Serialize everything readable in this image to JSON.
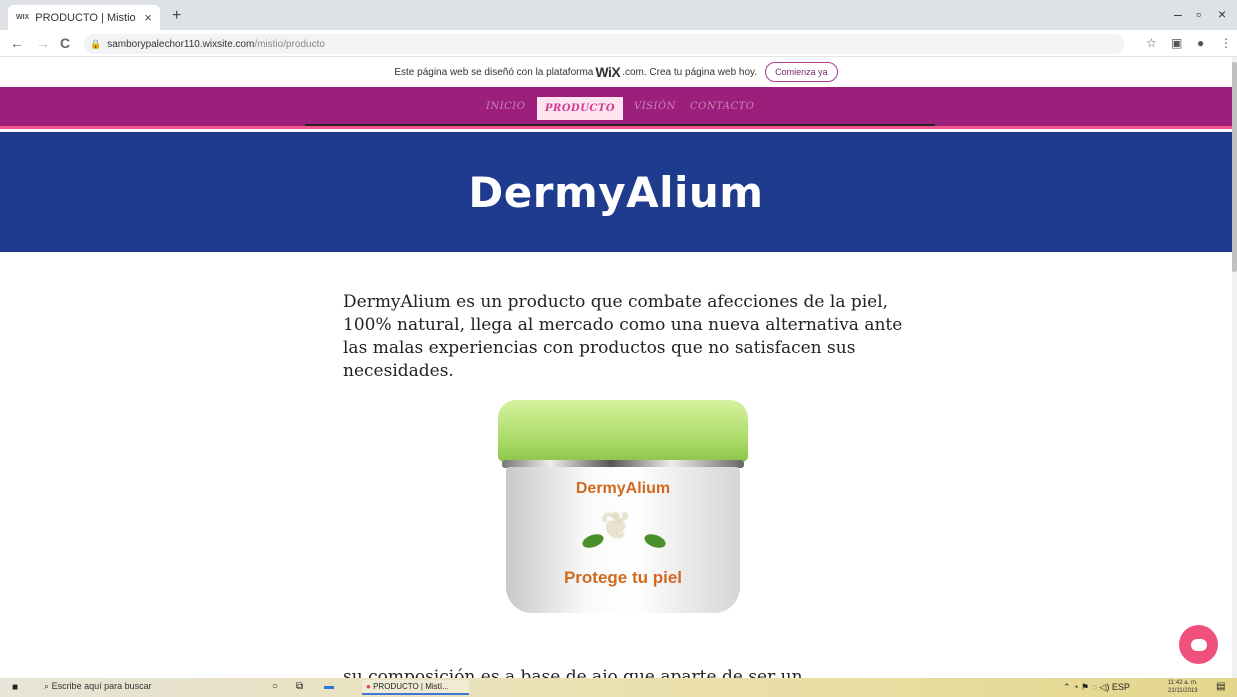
{
  "browser": {
    "tab_favicon": "WIX",
    "tab_title": "PRODUCTO | Mistio",
    "tab_close": "×",
    "new_tab": "+",
    "url_host": "samborypalechor110.wixsite.com",
    "url_path": "/mistio/producto",
    "back_icon": "←",
    "forward_icon": "→",
    "reload_icon": "C",
    "minimize_icon": "–",
    "maximize_icon": "▫",
    "close_icon": "×",
    "star_icon": "☆"
  },
  "wix_banner": {
    "text_before": "Este página web se diseñó con la plataforma",
    "logo": "WiX",
    "text_after": ".com. Crea tu página web hoy.",
    "cta": "Comienza ya"
  },
  "site_nav": {
    "items": [
      {
        "label": "INICIO"
      },
      {
        "label": "PRODUCTO"
      },
      {
        "label": "VISIÓN"
      },
      {
        "label": "CONTACTO"
      }
    ]
  },
  "hero": {
    "title": "DermyAlium"
  },
  "content": {
    "paragraph1": "DermyAlium es un producto que combate afecciones de la piel, 100% natural, llega al mercado como una nueva alternativa ante las malas experiencias con productos que no satisfacen sus necesidades.",
    "paragraph2": "su composición es a base de ajo que aparte de ser un",
    "product_brand": "DermyAlium",
    "product_tagline": "Protege tu piel"
  },
  "taskbar": {
    "search_placeholder": "Escribe aquí para buscar",
    "app_label": "PRODUCTO | Mistí...",
    "lang": "ESP",
    "time": "11:42 a. m.",
    "date": "21/11/2019"
  },
  "colors": {
    "nav_bg": "#9c1f7b",
    "hero_bg": "#1f3b8e",
    "accent_pink": "#f0517c"
  }
}
